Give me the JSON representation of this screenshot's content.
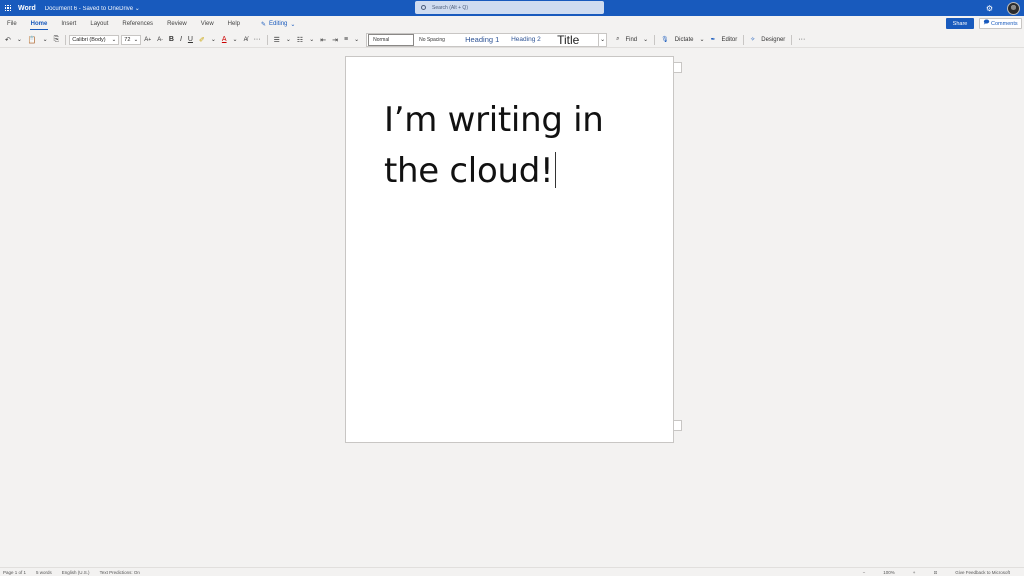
{
  "titlebar": {
    "app_name": "Word",
    "doc_name": "Document 6 - Saved to OneDrive ⌄",
    "search_placeholder": "Search (Alt + Q)"
  },
  "tabs": [
    {
      "label": "File"
    },
    {
      "label": "Home"
    },
    {
      "label": "Insert"
    },
    {
      "label": "Layout"
    },
    {
      "label": "References"
    },
    {
      "label": "Review"
    },
    {
      "label": "View"
    },
    {
      "label": "Help"
    }
  ],
  "editing_label": "Editing",
  "share_label": "Share",
  "comments_label": "Comments",
  "ribbon": {
    "font_name": "Calibri (Body)",
    "font_size": "72",
    "bold": "B",
    "italic": "I",
    "underline": "U",
    "font_color": "A",
    "more": "···",
    "styles": [
      "Normal",
      "No Spacing",
      "Heading 1",
      "Heading 2",
      "Title"
    ],
    "find_label": "Find",
    "dictate_label": "Dictate",
    "editor_label": "Editor",
    "designer_label": "Designer"
  },
  "document": {
    "text": "I’m writing in the cloud!"
  },
  "status": {
    "page": "Page 1 of 1",
    "words": "5 words",
    "language": "English (U.S.)",
    "predictions": "Text Predictions: On",
    "zoom": "100%",
    "feedback": "Give Feedback to Microsoft"
  },
  "colors": {
    "brand": "#185abd",
    "heading": "#2f5496"
  }
}
